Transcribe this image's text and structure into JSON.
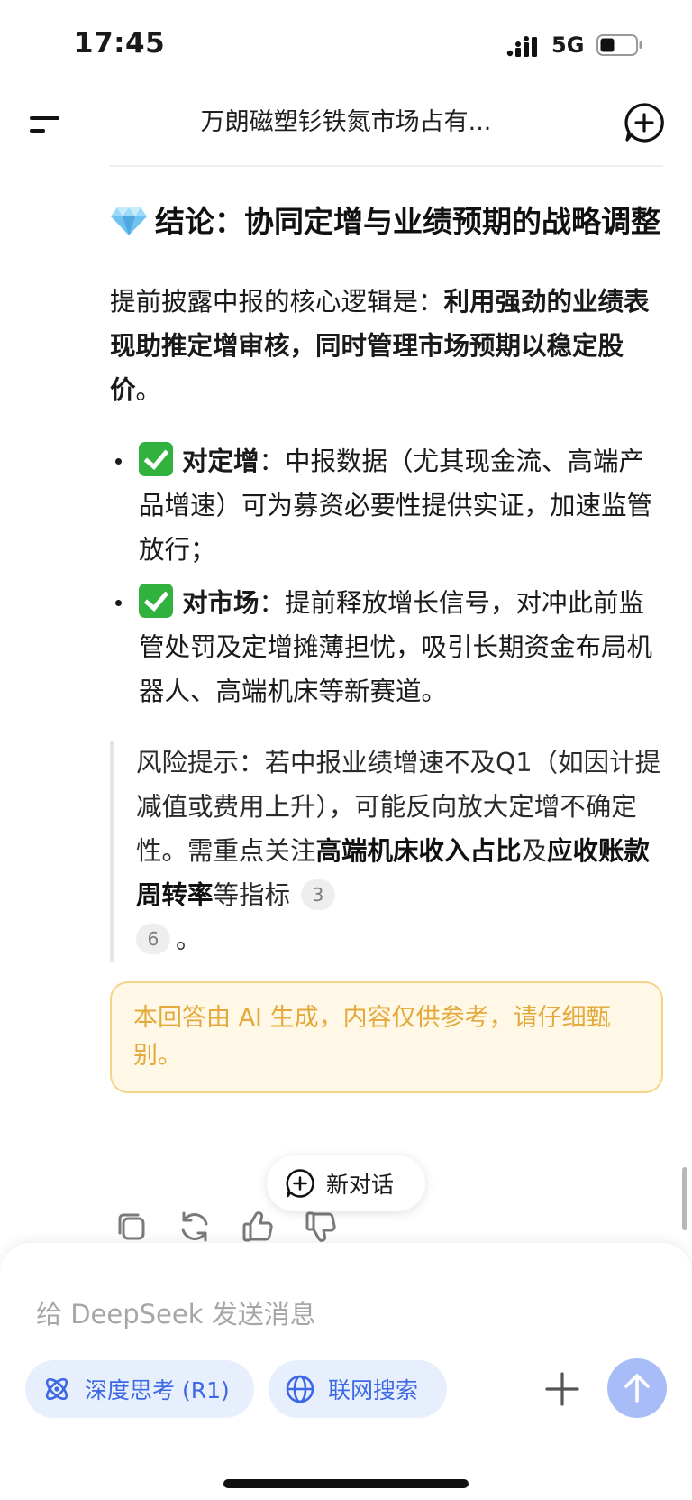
{
  "status_bar": {
    "time": "17:45",
    "network": "5G"
  },
  "header": {
    "title": "万朗磁塑钐铁氮市场占有..."
  },
  "message": {
    "heading": "结论：协同定增与业绩预期的战略调整",
    "intro_prefix": "提前披露中报的核心逻辑是：",
    "intro_bold": "利用强劲的业绩表现助推定增审核，同时管理市场预期以稳定股价",
    "intro_suffix": "。",
    "bullets": [
      {
        "label": "对定增",
        "text": "：中报数据（尤其现金流、高端产品增速）可为募资必要性提供实证，加速监管放行；"
      },
      {
        "label": "对市场",
        "text": "：提前释放增长信号，对冲此前监管处罚及定增摊薄担忧，吸引长期资金布局机器人、高端机床等新赛道。"
      }
    ],
    "risk": {
      "prefix": "风险提示：若中报业绩增速不及Q1（如因计提减值或费用上升），可能反向放大定增不确定性。需重点关注",
      "bold1": "高端机床收入占比",
      "mid": "及",
      "bold2": "应收账款周转率",
      "suffix": "等指标",
      "cite1": "3",
      "cite2": "6",
      "end": "。"
    },
    "ai_notice": "本回答由 AI 生成，内容仅供参考，请仔细甄别。"
  },
  "new_chat_label": "新对话",
  "composer": {
    "placeholder": "给 DeepSeek 发送消息",
    "deep_think_label": "深度思考 (R1)",
    "web_search_label": "联网搜索"
  },
  "colors": {
    "accent": "#3c68e6",
    "chip_bg": "#e8effc",
    "send_bg": "#a8bdf8",
    "notice_text": "#e4a93a",
    "notice_bg": "#fff8e6",
    "check_green": "#31b13d"
  },
  "icons": [
    "gem-icon",
    "check-icon",
    "menu-icon",
    "new-chat-icon",
    "copy-icon",
    "regenerate-icon",
    "thumbs-up-icon",
    "thumbs-down-icon",
    "atom-icon",
    "globe-icon",
    "plus-icon",
    "send-arrow-icon"
  ]
}
